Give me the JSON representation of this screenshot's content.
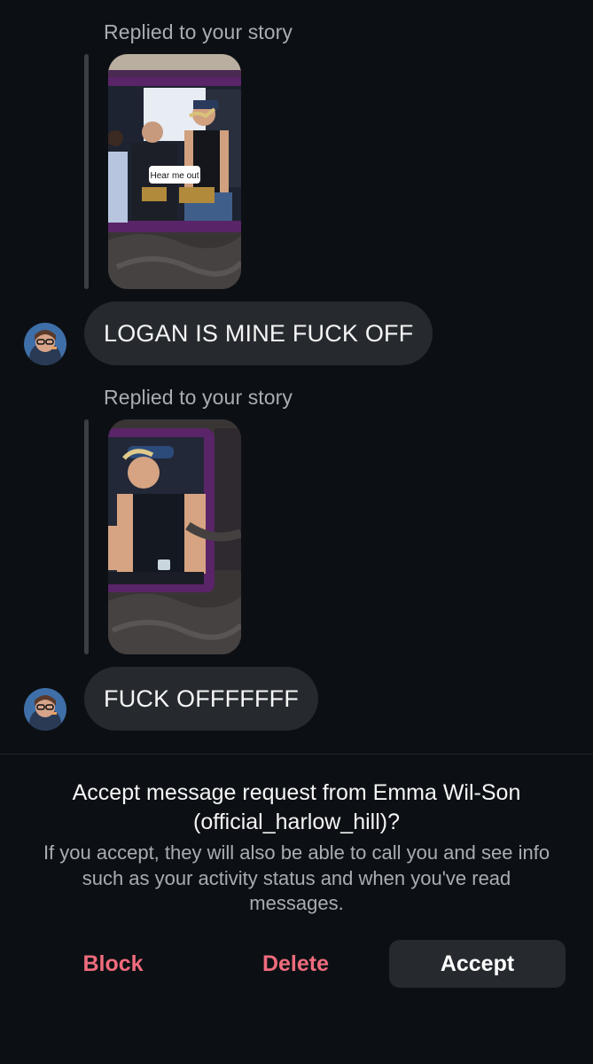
{
  "thread": {
    "messages": [
      {
        "reply_label": "Replied to your story",
        "story_caption": "Hear me out",
        "text": "LOGAN IS MINE FUCK OFF"
      },
      {
        "reply_label": "Replied to your story",
        "text": "FUCK OFFFFFFF"
      }
    ]
  },
  "request": {
    "title": "Accept message request from Emma Wil-Son (official_harlow_hill)?",
    "description": "If you accept, they will also be able to call you and see info such as your activity status and when you've read messages.",
    "actions": {
      "block": "Block",
      "delete": "Delete",
      "accept": "Accept"
    }
  },
  "colors": {
    "background": "#0c1014",
    "bubble": "#262a2f",
    "secondary_text": "#a8adb3",
    "danger": "#ef6b7d",
    "device_frame_purple": "#6a2a78"
  },
  "icons": {
    "avatar": "profile-photo"
  }
}
